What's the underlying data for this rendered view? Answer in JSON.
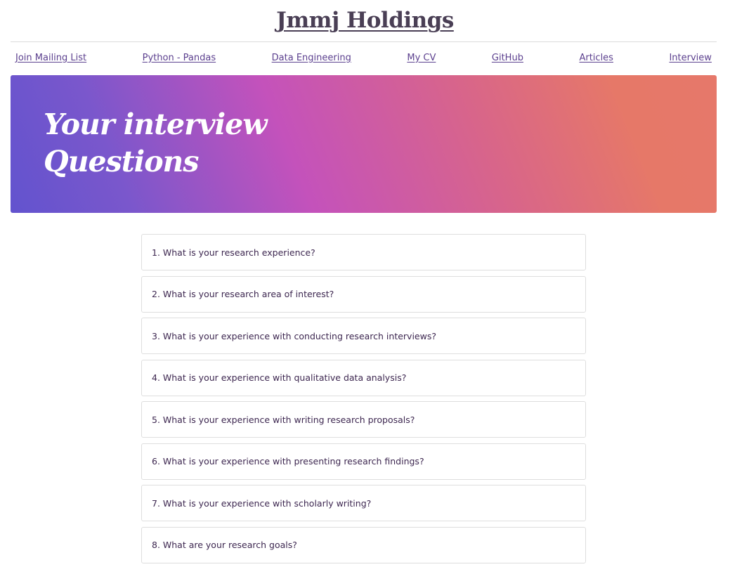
{
  "site": {
    "title": "Jmmj Holdings"
  },
  "nav": {
    "items": [
      "Join Mailing List",
      "Python - Pandas",
      "Data Engineering",
      "My CV",
      "GitHub",
      "Articles",
      "Interview"
    ]
  },
  "hero": {
    "title_line1": "Your interview",
    "title_line2": "Questions"
  },
  "questions": [
    "1. What is your research experience?",
    "2. What is your research area of interest?",
    "3. What is your experience with conducting research interviews?",
    "4. What is your experience with qualitative data analysis?",
    "5. What is your experience with writing research proposals?",
    "6. What is your experience with presenting research findings?",
    "7. What is your experience with scholarly writing?",
    "8. What are your research goals?"
  ],
  "colors": {
    "gradient_start": "#6253ce",
    "gradient_mid": "#c452bb",
    "gradient_end": "#e6786a",
    "link": "#5b3f8e",
    "text": "#3d2750"
  }
}
